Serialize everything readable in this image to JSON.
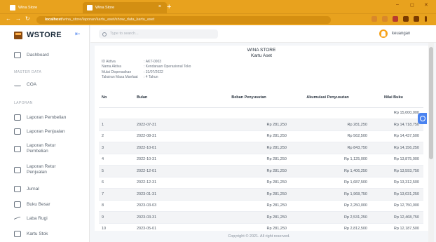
{
  "browser": {
    "tabs": [
      {
        "title": "Wina Store"
      },
      {
        "title": "Wina Store"
      }
    ],
    "new_tab": "+",
    "url_host": "localhost",
    "url_path": "/wina_store/laporan/kartu_aset/show_data_kartu_aset"
  },
  "sidebar": {
    "brand": "WSTORE",
    "sections": {
      "master": "MASTER DATA",
      "laporan": "LAPORAN"
    },
    "items": [
      {
        "label": "Dashboard"
      },
      {
        "label": "COA"
      },
      {
        "label": "Laporan Pembelian"
      },
      {
        "label": "Laporan Penjualan"
      },
      {
        "label": "Laporan Retur Pembelian"
      },
      {
        "label": "Laporan Retur Penjualan"
      },
      {
        "label": "Jurnal"
      },
      {
        "label": "Buku Besar"
      },
      {
        "label": "Laba Rugi"
      },
      {
        "label": "Kartu Stok"
      }
    ]
  },
  "topbar": {
    "search_placeholder": "Type to search...",
    "username": "keuangan"
  },
  "report": {
    "company": "WINA STORE",
    "title": "Kartu Aset",
    "meta": [
      {
        "k": "ID Aktiva",
        "v": "AKT-0003"
      },
      {
        "k": "Nama Aktiva",
        "v": "Kendaraan Operasional Toko"
      },
      {
        "k": "Mulai Disperasikan",
        "v": "31/07/2022"
      },
      {
        "k": "Taksiran Masa Manfaat",
        "v": "4 Tahun"
      }
    ],
    "columns": [
      "No",
      "Bulan",
      "Beban Penyusutan",
      "Akumulasi Penyusutan",
      "Nilai Buku"
    ],
    "rows": [
      [
        "",
        "",
        "",
        "",
        "Rp 15,000,000"
      ],
      [
        "1",
        "2022-07-31",
        "Rp 281,250",
        "Rp 281,250",
        "Rp 14,718,750"
      ],
      [
        "2",
        "2022-08-31",
        "Rp 281,250",
        "Rp 562,500",
        "Rp 14,437,500"
      ],
      [
        "3",
        "2022-10-01",
        "Rp 281,250",
        "Rp 843,750",
        "Rp 14,156,250"
      ],
      [
        "4",
        "2022-10-31",
        "Rp 281,250",
        "Rp 1,125,000",
        "Rp 13,875,000"
      ],
      [
        "5",
        "2022-12-01",
        "Rp 281,250",
        "Rp 1,406,250",
        "Rp 13,593,750"
      ],
      [
        "6",
        "2022-12-31",
        "Rp 281,250",
        "Rp 1,687,500",
        "Rp 13,312,500"
      ],
      [
        "7",
        "2023-01-31",
        "Rp 281,250",
        "Rp 1,968,750",
        "Rp 13,031,250"
      ],
      [
        "8",
        "2023-03-03",
        "Rp 281,250",
        "Rp 2,250,000",
        "Rp 12,750,000"
      ],
      [
        "9",
        "2023-03-31",
        "Rp 281,250",
        "Rp 2,531,250",
        "Rp 12,468,750"
      ],
      [
        "10",
        "2023-05-01",
        "Rp 281,250",
        "Rp 2,812,500",
        "Rp 12,187,500"
      ]
    ]
  },
  "footer": "Copyright © 2021. All right reserved."
}
